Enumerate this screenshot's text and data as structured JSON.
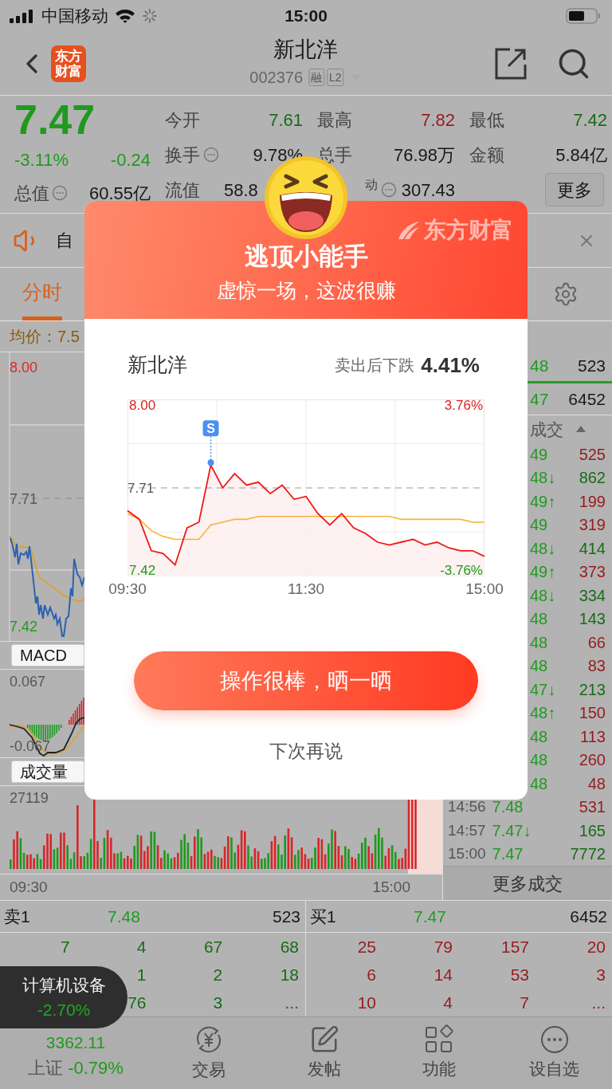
{
  "status_bar": {
    "carrier": "中国移动",
    "time": "15:00"
  },
  "header": {
    "logo": [
      "东方",
      "财富"
    ],
    "title": "新北洋",
    "code": "002376",
    "badges": [
      "融",
      "L2"
    ]
  },
  "quote": {
    "price": "7.47",
    "change_pct": "-3.11%",
    "change": "-0.24",
    "total_value": {
      "label": "总值",
      "info": true,
      "value": "60.55亿"
    },
    "stats": [
      {
        "kind": "normal",
        "label": "今开",
        "value": "7.61",
        "color": "#166c16",
        "info": false
      },
      {
        "kind": "normal",
        "label": "最高",
        "value": "7.82",
        "color": "#971b1d",
        "info": false
      },
      {
        "kind": "normal",
        "label": "最低",
        "value": "7.42",
        "color": "#166c16",
        "info": false
      },
      {
        "kind": "normal",
        "label": "换手",
        "value": "9.78%",
        "color": "#181818",
        "info": true
      },
      {
        "kind": "normal",
        "label": "总手",
        "value": "76.98万",
        "color": "#181818",
        "info": false
      },
      {
        "kind": "normal",
        "label": "金额",
        "value": "5.84亿",
        "color": "#181818",
        "info": false
      },
      {
        "kind": "cut_value",
        "label": "流值",
        "value": "58.8",
        "color": "#181818",
        "info": false
      },
      {
        "kind": "cut_label",
        "label": "动",
        "value": "307.43",
        "color": "#181818",
        "info": true
      }
    ],
    "more_button": "更多"
  },
  "notice": {
    "text": "自"
  },
  "tabs": [
    {
      "label": "分时",
      "selected": true
    }
  ],
  "chart": {
    "avg_price": "均价：7.5",
    "high": "8.00",
    "prev": "7.71",
    "low": "7.42",
    "macd": {
      "label": "MACD",
      "max": "0.067",
      "min": "-0.067"
    },
    "volume": {
      "label": "成交量",
      "max": "27119",
      "start": "09:30",
      "end": "15:00"
    }
  },
  "trades": {
    "top": [
      {
        "price": "48",
        "volume": "523"
      },
      {
        "price": "47",
        "volume": "6452"
      }
    ],
    "header": "成交",
    "rows": [
      {
        "price": "49",
        "volume": "525",
        "color": "#971b1d"
      },
      {
        "price": "48↓",
        "volume": "862",
        "color": "#166c16"
      },
      {
        "price": "49↑",
        "volume": "199",
        "color": "#971b1d"
      },
      {
        "price": "49",
        "volume": "319",
        "color": "#971b1d"
      },
      {
        "price": "48↓",
        "volume": "414",
        "color": "#166c16"
      },
      {
        "price": "49↑",
        "volume": "373",
        "color": "#971b1d"
      },
      {
        "price": "48↓",
        "volume": "334",
        "color": "#166c16"
      },
      {
        "price": "48",
        "volume": "143",
        "color": "#166c16"
      },
      {
        "price": "48",
        "volume": "66",
        "color": "#971b1d"
      },
      {
        "price": "48",
        "volume": "83",
        "color": "#971b1d"
      },
      {
        "price": "47↓",
        "volume": "213",
        "color": "#166c16"
      },
      {
        "price": "48↑",
        "volume": "150",
        "color": "#971b1d"
      },
      {
        "price": "48",
        "volume": "113",
        "color": "#971b1d"
      },
      {
        "price": "48",
        "volume": "260",
        "color": "#971b1d"
      },
      {
        "price": "48",
        "volume": "48",
        "color": "#971b1d"
      },
      {
        "time": "14:56",
        "price": "7.48",
        "volume": "531",
        "color": "#971b1d"
      },
      {
        "time": "14:57",
        "price": "7.47↓",
        "volume": "165",
        "color": "#166c16"
      },
      {
        "time": "15:00",
        "price": "7.47",
        "volume": "7772",
        "color": "#166c16"
      }
    ],
    "more": "更多成交"
  },
  "order_book": {
    "sides": [
      {
        "color": "#166c16",
        "label": "卖1",
        "price": "7.48",
        "volume": "523",
        "queue": [
          [
            "7",
            "4",
            "67",
            "68"
          ],
          [
            "1",
            "2",
            "18"
          ],
          [
            "76",
            "3",
            "..."
          ]
        ]
      },
      {
        "color": "#971b1d",
        "label": "买1",
        "price": "7.47",
        "volume": "6452",
        "queue": [
          [
            "25",
            "79",
            "157",
            "20"
          ],
          [
            "6",
            "14",
            "53",
            "3"
          ],
          [
            "10",
            "4",
            "7",
            "..."
          ]
        ]
      }
    ]
  },
  "toast": {
    "name": "计算机设备",
    "change": "-2.70%"
  },
  "bottom_nav": {
    "index_value": "3362.11",
    "index_name": "上证",
    "index_change": "-0.79%",
    "items": [
      {
        "kind": "trade",
        "label": "交易"
      },
      {
        "kind": "post",
        "label": "发帖"
      },
      {
        "kind": "apps",
        "label": "功能"
      },
      {
        "kind": "watch",
        "label": "设自选"
      }
    ]
  },
  "modal": {
    "brand": "东方财富",
    "title": "逃顶小能手",
    "subtitle": "虚惊一场，这波很赚",
    "stock": "新北洋",
    "result_label": "卖出后下跌",
    "result_value": "4.41%",
    "chart_data": {
      "type": "line",
      "categories": [
        "09:30",
        null,
        null,
        null,
        null,
        null,
        null,
        null,
        null,
        null,
        null,
        null,
        null,
        null,
        null,
        "11:30",
        null,
        null,
        null,
        null,
        null,
        null,
        null,
        null,
        null,
        null,
        null,
        null,
        null,
        null,
        "15:00"
      ],
      "series": [
        {
          "color": "#f01818",
          "values": [
            7.63,
            7.6,
            7.49,
            7.48,
            7.44,
            7.57,
            7.59,
            7.79,
            7.71,
            7.76,
            7.72,
            7.73,
            7.69,
            7.72,
            7.67,
            7.68,
            7.62,
            7.58,
            7.62,
            7.57,
            7.55,
            7.52,
            7.51,
            7.52,
            7.53,
            7.51,
            7.52,
            7.5,
            7.49,
            7.49,
            7.47
          ]
        },
        {
          "color": "#999999",
          "line_style": "dashed",
          "values": [
            7.71,
            7.71,
            7.71,
            7.71,
            7.71,
            7.71,
            7.71,
            7.71,
            7.71,
            7.71,
            7.71,
            7.71,
            7.71,
            7.71,
            7.71,
            7.71,
            7.71,
            7.71,
            7.71,
            7.71,
            7.71,
            7.71,
            7.71,
            7.71,
            7.71,
            7.71,
            7.71,
            7.71,
            7.71,
            7.71,
            7.71
          ]
        },
        {
          "color": "#f7b33c",
          "values": [
            7.62,
            7.6,
            7.56,
            7.54,
            7.53,
            7.53,
            7.53,
            7.58,
            7.59,
            7.6,
            7.6,
            7.61,
            7.61,
            7.61,
            7.61,
            7.61,
            7.61,
            7.61,
            7.61,
            7.61,
            7.61,
            7.61,
            7.61,
            7.6,
            7.6,
            7.6,
            7.6,
            7.6,
            7.6,
            7.59,
            7.59
          ]
        }
      ],
      "ylim": [
        7.4,
        8.02
      ],
      "yticks": [
        {
          "value": 8.0,
          "label": "8.00"
        },
        {
          "value": 7.71,
          "label": "7.71"
        },
        {
          "value": 7.42,
          "label": "7.42"
        }
      ],
      "annotations": [
        "S"
      ]
    },
    "right_labels": [
      "3.76%",
      "-3.76%"
    ],
    "share_button": "操作很棒，晒一晒",
    "dismiss": "下次再说"
  }
}
